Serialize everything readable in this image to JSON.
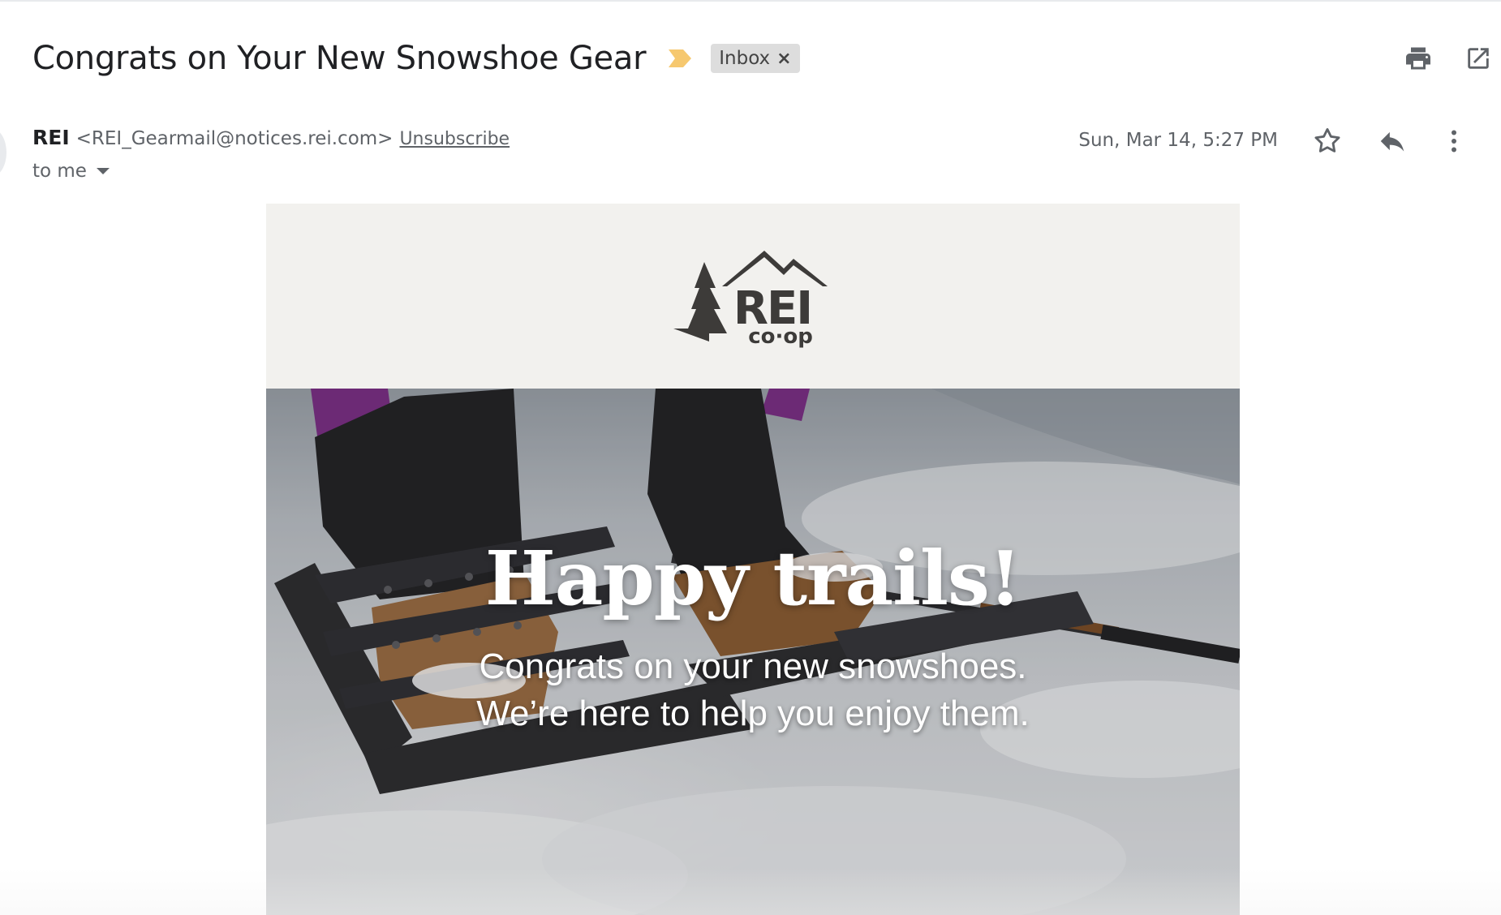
{
  "email": {
    "subject": "Congrats on Your New Snowshoe Gear",
    "label": "Inbox",
    "label_remove": "×",
    "sender_name": "REI",
    "sender_email": "<REI_Gearmail@notices.rei.com>",
    "unsubscribe": "Unsubscribe",
    "recipient": "to me",
    "timestamp": "Sun, Mar 14, 5:27 PM"
  },
  "icons": {
    "importance": "importance-marker-icon",
    "print": "print-icon",
    "open_new_window": "open-in-new-window-icon",
    "star": "star-icon",
    "reply": "reply-icon",
    "more": "more-vert-icon",
    "recipient_details": "caret-down-icon"
  },
  "colors": {
    "importance": "#f6c86f",
    "label_chip_bg": "#dddddd",
    "banner_bg": "#f2f1ee",
    "logo": "#3d3b39",
    "text_primary": "#202124",
    "text_secondary": "#5f6368"
  },
  "newsletter": {
    "logo_main": "REI",
    "logo_sub": "co·op",
    "headline": "Happy trails!",
    "subline_1": "Congrats on your new snowshoes.",
    "subline_2": "We’re here to help you enjoy them."
  }
}
